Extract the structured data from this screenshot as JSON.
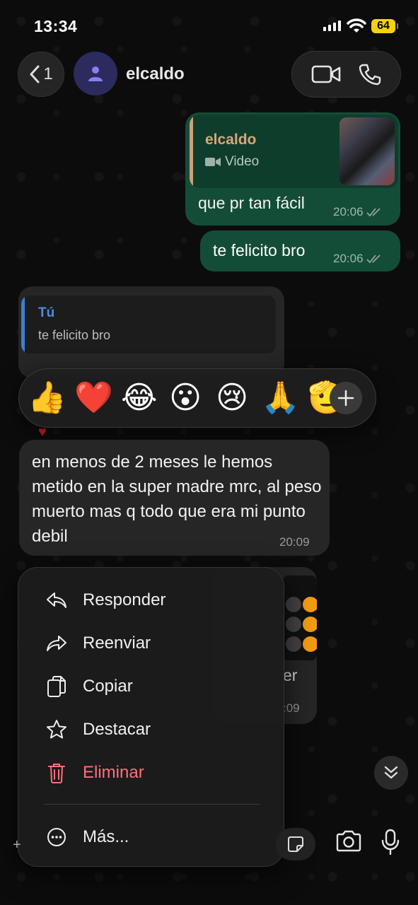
{
  "status_bar": {
    "time": "13:34",
    "battery": "64"
  },
  "header": {
    "back_count": "1",
    "contact_name": "elcaldo"
  },
  "messages": {
    "quoted_video": {
      "author": "elcaldo",
      "type_label": "Video"
    },
    "out1": {
      "text": "que pr tan fácil",
      "time": "20:06"
    },
    "out2": {
      "text": "te felicito bro",
      "time": "20:06"
    },
    "reply_quote": {
      "author": "Tú",
      "text": "te felicito bro"
    },
    "in_main": {
      "text": "en menos de 2 meses le hemos metido en la super madre mrc, al peso muerto mas q todo que era mi punto debil",
      "time": "20:09"
    },
    "partial": {
      "text_fragment": "er",
      "time_fragment": ":09"
    }
  },
  "reactions": [
    "👍",
    "❤️",
    "😂",
    "😮",
    "😢",
    "🙏",
    "🫡"
  ],
  "context_menu": {
    "reply": "Responder",
    "forward": "Reenviar",
    "copy": "Copiar",
    "star": "Destacar",
    "delete": "Eliminar",
    "more": "Más..."
  },
  "colors": {
    "outgoing_bubble": "#144d37",
    "incoming_bubble": "#262626",
    "quote_author_color": "#d7a77b",
    "self_quote_color": "#4a90e2",
    "danger": "#ff6f7c",
    "battery": "#f5d20a"
  }
}
